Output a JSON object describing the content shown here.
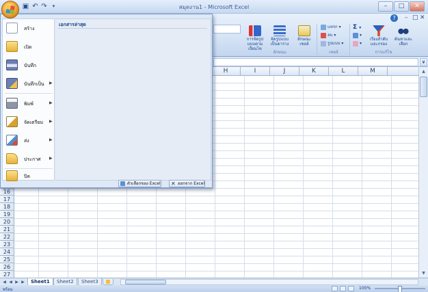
{
  "window": {
    "title": "สมุดงาน1 - Microsoft Excel",
    "minimize": "–",
    "maximize": "□",
    "close": "✕"
  },
  "ribbon": {
    "groups": [
      {
        "label": "",
        "buttons": [
          {
            "label": "การจัดรูปแบบตามเงื่อนไข",
            "icon": "conditional-format-icon"
          },
          {
            "label": "จัดรูปแบบเป็นตาราง",
            "icon": "format-table-icon"
          },
          {
            "label": "ลักษณะเซลล์",
            "icon": "cell-styles-icon"
          }
        ],
        "group_label": "ลักษณะ"
      },
      {
        "buttons": [
          {
            "label": "แทรก",
            "icon": "insert-icon"
          },
          {
            "label": "ลบ",
            "icon": "delete-icon"
          },
          {
            "label": "รูปแบบ",
            "icon": "format-icon"
          }
        ],
        "group_label": "เซลล์"
      },
      {
        "buttons": [
          {
            "label": "Σ",
            "icon": "autosum-icon"
          },
          {
            "label": "เรียงลำดับและกรอง",
            "icon": "sort-filter-icon"
          },
          {
            "label": "ค้นหาและเลือก",
            "icon": "find-select-icon"
          }
        ],
        "group_label": "การแก้ไข"
      }
    ]
  },
  "grid": {
    "columns": [
      "H",
      "I",
      "J",
      "K",
      "L",
      "M"
    ],
    "rows": [
      "16",
      "17",
      "18",
      "19",
      "20",
      "21",
      "22",
      "23",
      "24",
      "25",
      "26",
      "27"
    ]
  },
  "sheets": {
    "tabs": [
      "Sheet1",
      "Sheet2",
      "Sheet3"
    ],
    "active": "Sheet1"
  },
  "status": {
    "text": "พร้อม",
    "zoom": "100%"
  },
  "office_menu": {
    "items": [
      {
        "label": "สร้าง",
        "icon": "new-document-icon",
        "has_submenu": false
      },
      {
        "label": "เปิด",
        "icon": "open-folder-icon",
        "has_submenu": false
      },
      {
        "label": "บันทึก",
        "icon": "save-disk-icon",
        "has_submenu": false
      },
      {
        "label": "บันทึกเป็น",
        "icon": "save-as-icon",
        "has_submenu": true
      },
      {
        "label": "พิมพ์",
        "icon": "printer-icon",
        "has_submenu": true
      },
      {
        "label": "จัดเตรียม",
        "icon": "prepare-icon",
        "has_submenu": true
      },
      {
        "label": "ส่ง",
        "icon": "send-icon",
        "has_submenu": true
      },
      {
        "label": "ประกาศ",
        "icon": "publish-icon",
        "has_submenu": true
      },
      {
        "label": "ปิด",
        "icon": "close-folder-icon",
        "has_submenu": false
      }
    ],
    "recent_heading": "เอกสารล่าสุด",
    "options_button": "ตัวเลือกของ Excel",
    "exit_button": "ออกจาก Excel"
  },
  "colors": {
    "ribbon_text": "#15428b",
    "menu_background": "#dfe8f5",
    "grid_line": "#d4dde9"
  }
}
